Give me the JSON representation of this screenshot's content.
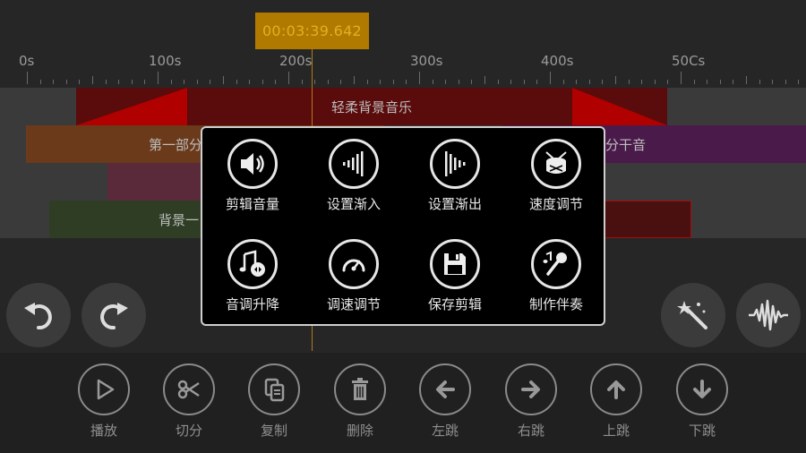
{
  "timeline": {
    "current_time": "00:03:39.642",
    "ruler_labels": [
      "0s",
      "100s",
      "200s",
      "300s",
      "400s",
      "50Cs"
    ]
  },
  "tracks": [
    {
      "clips": [
        {
          "label": "轻柔背景音乐",
          "color": "#5a0b0b"
        }
      ]
    },
    {
      "clips": [
        {
          "label": "第一部分",
          "color": "#6a3a1a"
        },
        {
          "label": "分干音",
          "color": "#4a1a4a"
        }
      ]
    },
    {
      "clips": [
        {
          "label": "",
          "color": "#5a2a3a"
        }
      ]
    },
    {
      "clips": [
        {
          "label": "背景一",
          "color": "#2e3d24"
        },
        {
          "label": "",
          "color": "#4a1010"
        }
      ]
    }
  ],
  "side_buttons": {
    "undo": "undo-icon",
    "redo": "redo-icon",
    "effects": "magic-wand-icon",
    "waveform": "waveform-icon"
  },
  "toolbar": {
    "items": [
      {
        "label": "播放",
        "icon": "play-icon"
      },
      {
        "label": "切分",
        "icon": "scissors-icon"
      },
      {
        "label": "复制",
        "icon": "copy-icon"
      },
      {
        "label": "删除",
        "icon": "trash-icon"
      },
      {
        "label": "左跳",
        "icon": "arrow-left-icon"
      },
      {
        "label": "右跳",
        "icon": "arrow-right-icon"
      },
      {
        "label": "上跳",
        "icon": "arrow-up-icon"
      },
      {
        "label": "下跳",
        "icon": "arrow-down-icon"
      }
    ]
  },
  "menu": {
    "items": [
      {
        "label": "剪辑音量",
        "icon": "volume-icon"
      },
      {
        "label": "设置渐入",
        "icon": "fade-in-icon"
      },
      {
        "label": "设置渐出",
        "icon": "fade-out-icon"
      },
      {
        "label": "速度调节",
        "icon": "drum-icon"
      },
      {
        "label": "音调升降",
        "icon": "pitch-icon"
      },
      {
        "label": "调速调节",
        "icon": "speedometer-icon"
      },
      {
        "label": "保存剪辑",
        "icon": "save-icon"
      },
      {
        "label": "制作伴奏",
        "icon": "microphone-icon"
      }
    ]
  }
}
